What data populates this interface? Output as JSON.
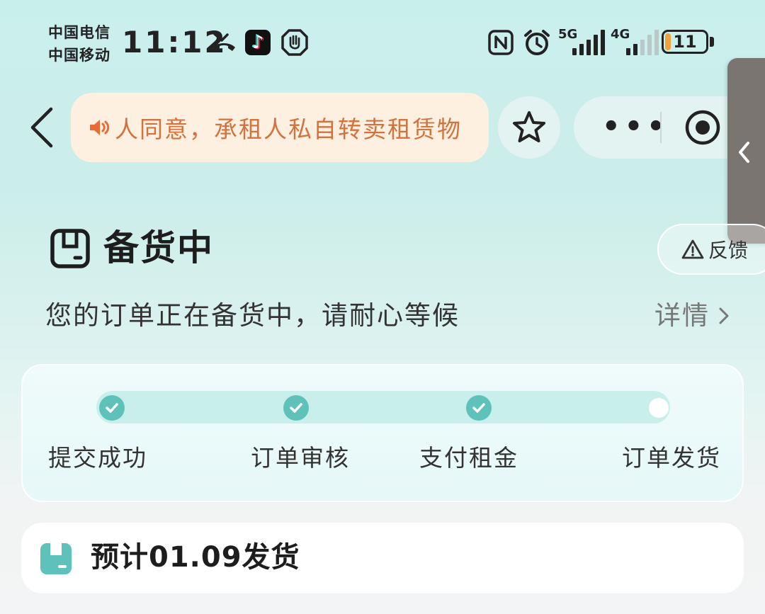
{
  "status_bar": {
    "carrier_1": "中国电信",
    "carrier_2": "中国移动",
    "time": "11:12",
    "icons": [
      "missed-call-icon",
      "tiktok-icon",
      "hand-stop-icon",
      "nfc-icon",
      "alarm-icon"
    ],
    "network_1": "5G",
    "network_2": "4G",
    "battery_level": "11",
    "battery_color": "#f2a23a"
  },
  "nav": {
    "notice_text": "人同意，承租人私自转卖租赁物",
    "notice_color": "#d4723e",
    "more_label": "•••"
  },
  "order_status": {
    "title": "备货中",
    "feedback_label": "反馈",
    "description": "您的订单正在备货中，请耐心等候",
    "detail_label": "详情"
  },
  "progress": {
    "steps": [
      {
        "label": "提交成功",
        "done": true
      },
      {
        "label": "订单审核",
        "done": true
      },
      {
        "label": "支付租金",
        "done": true
      },
      {
        "label": "订单发货",
        "done": false
      }
    ],
    "accent_color": "#5ec2bb"
  },
  "shipping": {
    "text": "预计01.09发货"
  }
}
